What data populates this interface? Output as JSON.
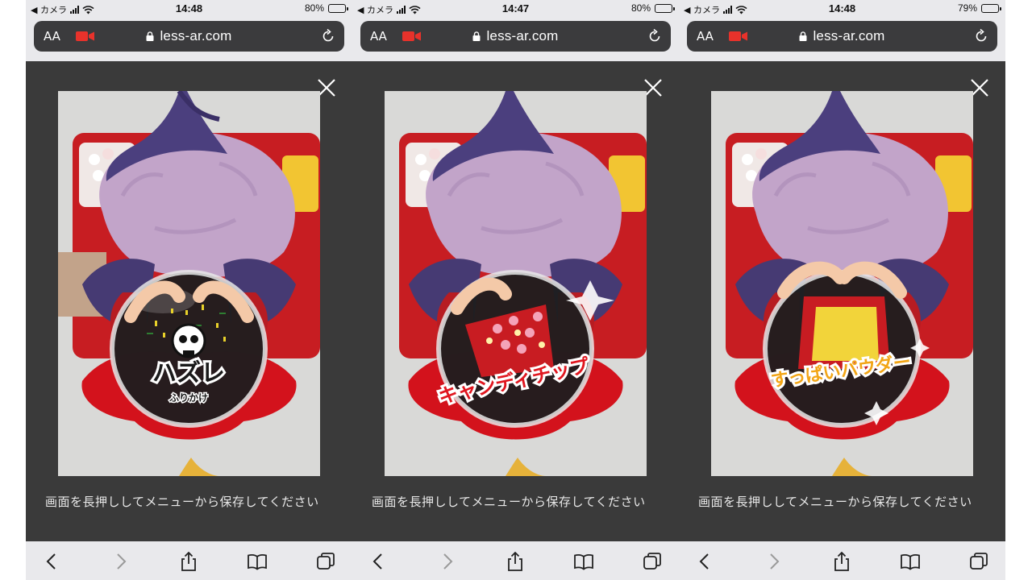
{
  "screens": [
    {
      "status": {
        "carrier": "◀ カメラ",
        "time": "14:48",
        "battery_text": "80%",
        "battery_level": 0.8
      },
      "browser": {
        "text_size_label": "AA",
        "url": "less-ar.com"
      },
      "message": "画面を長押ししてメニューから保存してください",
      "photo": {
        "label_main": "ハズレ",
        "label_sub": "ふりかけ",
        "label_color": "#1a1a1a",
        "label_outline": "#ffffff"
      }
    },
    {
      "status": {
        "carrier": "◀ カメラ",
        "time": "14:47",
        "battery_text": "80%",
        "battery_level": 0.8
      },
      "browser": {
        "text_size_label": "AA",
        "url": "less-ar.com"
      },
      "message": "画面を長押ししてメニューから保存してください",
      "photo": {
        "label_main": "キャンディチップ",
        "label_sub": "",
        "label_color": "#e0161f",
        "label_outline": "#ffffff"
      }
    },
    {
      "status": {
        "carrier": "◀ カメラ",
        "time": "14:48",
        "battery_text": "79%",
        "battery_level": 0.79
      },
      "browser": {
        "text_size_label": "AA",
        "url": "less-ar.com"
      },
      "message": "画面を長押ししてメニューから保存してください",
      "photo": {
        "label_main": "すっぱいパウダー",
        "label_sub": "",
        "label_color": "#f2a516",
        "label_outline": "#ffffff"
      }
    }
  ],
  "icons": {
    "camera": "video-camera-icon",
    "lock": "lock-icon",
    "reload": "reload-icon",
    "close": "close-icon",
    "back": "chevron-left-icon",
    "forward": "chevron-right-icon",
    "share": "share-icon",
    "bookmarks": "book-icon",
    "tabs": "tabs-icon"
  },
  "colors": {
    "chrome_bg": "#e9e9ec",
    "urlbar_bg": "#3b3b3d",
    "content_bg": "#3a3a3a",
    "record_red": "#e8322b",
    "hat_purple": "#4b3f7e",
    "cushion_red": "#d3121c"
  }
}
